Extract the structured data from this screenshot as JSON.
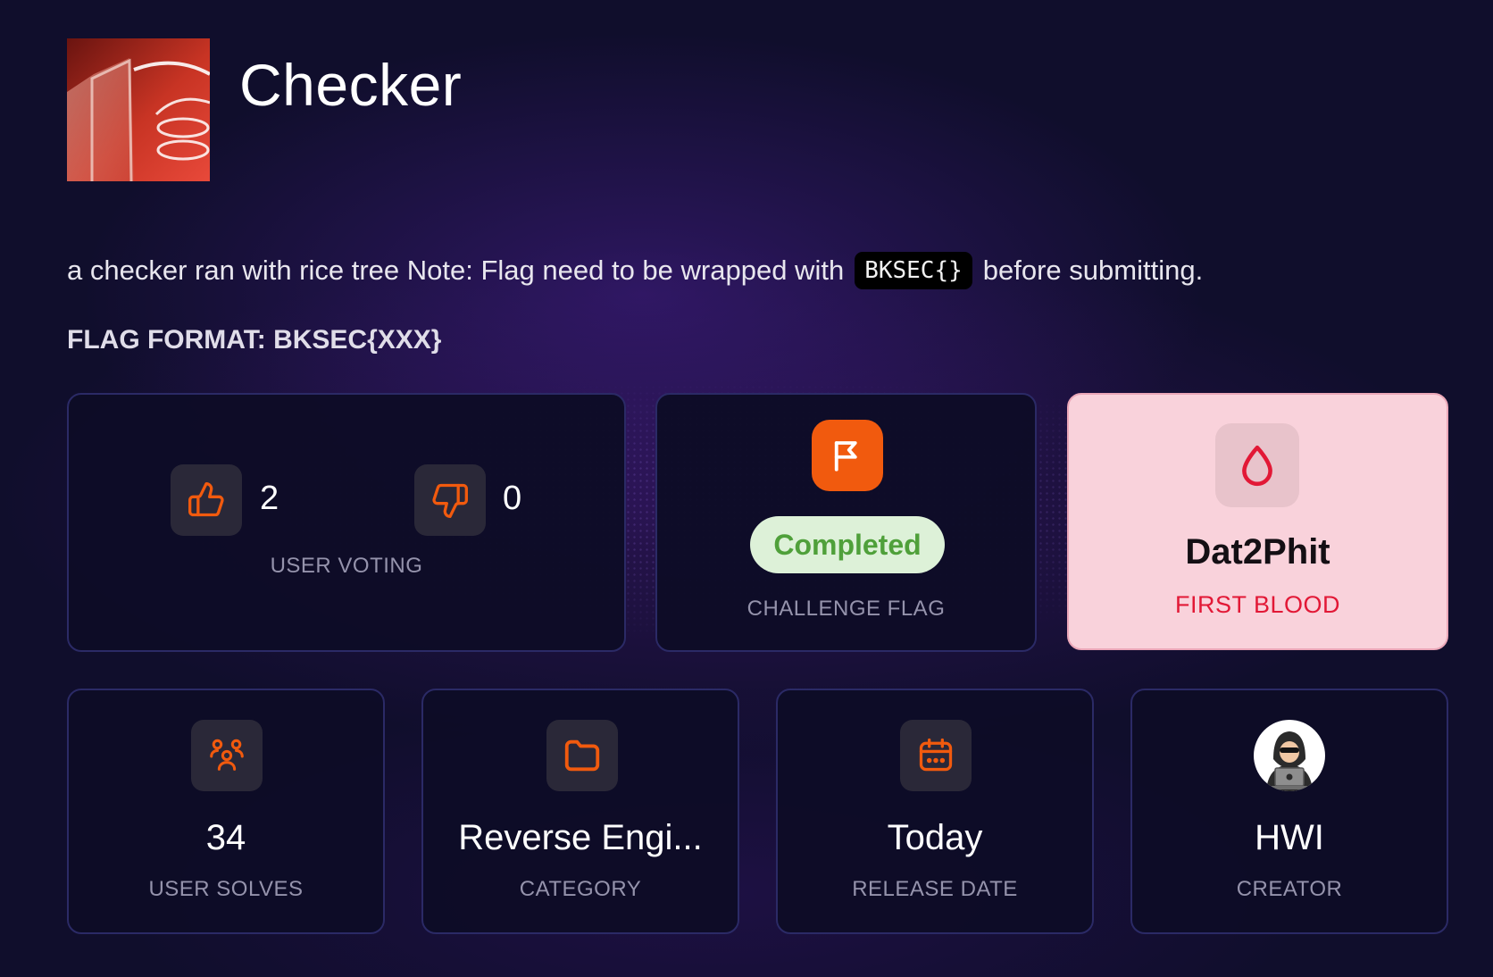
{
  "challenge": {
    "title": "Checker",
    "description_before": "a checker ran with rice tree Note: Flag need to be wrapped with",
    "description_code": "BKSEC{}",
    "description_after": "before submitting.",
    "flag_format": "FLAG FORMAT: BKSEC{XXX}"
  },
  "voting": {
    "upvotes": "2",
    "downvotes": "0",
    "label": "USER VOTING",
    "icons": [
      "thumbs-up-icon",
      "thumbs-down-icon"
    ]
  },
  "flag": {
    "status": "Completed",
    "label": "CHALLENGE FLAG",
    "icon": "flag-icon"
  },
  "first_blood": {
    "user": "Dat2Phit",
    "label": "FIRST BLOOD",
    "icon": "blood-drop-icon"
  },
  "stats": {
    "solves": {
      "value": "34",
      "label": "USER SOLVES",
      "icon": "users-icon"
    },
    "category": {
      "value": "Reverse Engi...",
      "label": "CATEGORY",
      "icon": "folder-icon"
    },
    "release": {
      "value": "Today",
      "label": "RELEASE DATE",
      "icon": "calendar-icon"
    },
    "creator": {
      "value": "HWI",
      "label": "CREATOR",
      "icon": "hacker-avatar-icon"
    }
  },
  "colors": {
    "background": "#100e2c",
    "accent_orange": "#f15a0e",
    "card_border": "#2b2a66",
    "completed_green": "#4fa03a",
    "first_blood_red": "#e21836",
    "first_blood_bg": "#f9d2db"
  }
}
